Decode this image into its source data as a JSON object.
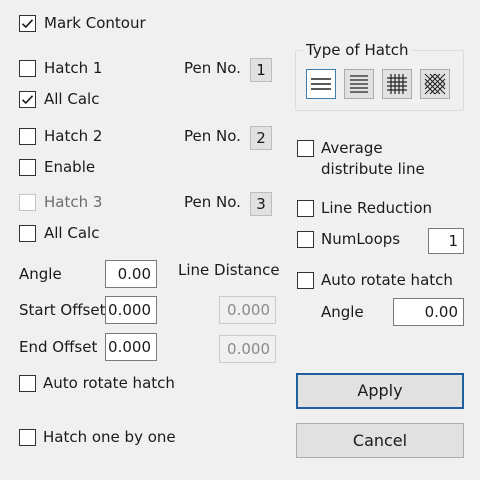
{
  "mark_contour": {
    "label": "Mark Contour",
    "checked": true
  },
  "hatch1": {
    "label": "Hatch 1",
    "checked": false,
    "pen_label": "Pen No.",
    "pen_no": "1",
    "all_calc": {
      "label": "All Calc",
      "checked": true
    }
  },
  "hatch2": {
    "label": "Hatch 2",
    "checked": false,
    "pen_label": "Pen No.",
    "pen_no": "2",
    "enable": {
      "label": "Enable",
      "checked": false
    }
  },
  "hatch3": {
    "label": "Hatch 3",
    "checked": false,
    "disabled": true,
    "pen_label": "Pen No.",
    "pen_no": "3",
    "all_calc": {
      "label": "All Calc",
      "checked": false
    }
  },
  "params": {
    "angle_label": "Angle",
    "angle_value": "0.00",
    "line_distance_label": "Line Distance",
    "start_offset_label": "Start Offset",
    "start_offset_value": "0.000",
    "start_offset_disabled_value": "0.000",
    "end_offset_label": "End Offset",
    "end_offset_value": "0.000",
    "end_offset_disabled_value": "0.000"
  },
  "auto_rotate_left": {
    "label": "Auto rotate hatch",
    "checked": false
  },
  "hatch_one_by_one": {
    "label": "Hatch one by one",
    "checked": false
  },
  "type_of_hatch": {
    "title": "Type of Hatch",
    "options": [
      {
        "icon": "horizontal-lines-hatch-icon",
        "selected": true
      },
      {
        "icon": "dense-horizontal-lines-hatch-icon",
        "selected": false
      },
      {
        "icon": "grid-hatch-icon",
        "selected": false
      },
      {
        "icon": "crosshatch-hatch-icon",
        "selected": false
      }
    ]
  },
  "average_distribute_line": {
    "label_line1": "Average",
    "label_line2": "distribute line",
    "checked": false
  },
  "line_reduction": {
    "label": "Line Reduction",
    "checked": false
  },
  "num_loops": {
    "label": "NumLoops",
    "checked": false,
    "value": "1"
  },
  "auto_rotate_right": {
    "label": "Auto rotate hatch",
    "checked": false,
    "angle_label": "Angle",
    "angle_value": "0.00"
  },
  "buttons": {
    "apply": "Apply",
    "cancel": "Cancel"
  },
  "colors": {
    "background": "#f0f0f0",
    "default_button_border": "#1f5fa0",
    "selected_hatch_border": "#3c7fb1"
  }
}
